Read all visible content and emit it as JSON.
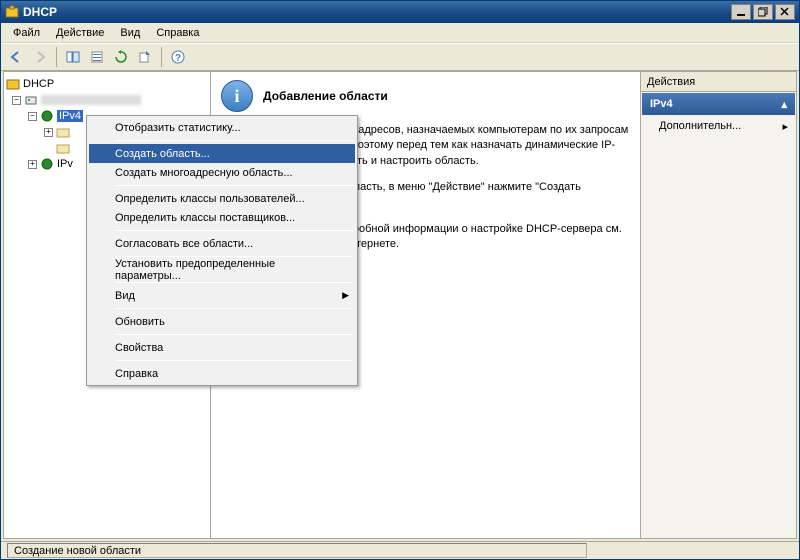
{
  "title": "DHCP",
  "menu": {
    "file": "Файл",
    "action": "Действие",
    "view": "Вид",
    "help": "Справка"
  },
  "tree": {
    "root": "DHCP",
    "server": "        ",
    "ipv4": "IPv4",
    "scope1": "",
    "scope2": "",
    "ipv6": "IPv"
  },
  "content": {
    "title": "Добавление области",
    "p1": "Область - это диапазон IP-адресов, назначаемых компьютерам по их запросам на получение IP-адреса. Поэтому перед тем как назначать динамические IP-адреса, необходимо создать и настроить область.",
    "p2": "Чтобы добавить новую область, в меню \"Действие\" нажмите \"Создать область\".",
    "p3": "Для получения более подробной информации о настройке DHCP-сервера см. электронную справку в Интернете."
  },
  "actions": {
    "header": "Действия",
    "subheader": "IPv4",
    "item1": "Дополнительн...",
    "arrow": "▸"
  },
  "context": {
    "i0": "Отобразить статистику...",
    "i1": "Создать область...",
    "i2": "Создать многоадресную область...",
    "i3": "Определить классы пользователей...",
    "i4": "Определить классы поставщиков...",
    "i5": "Согласовать все области...",
    "i6": "Установить предопределенные параметры...",
    "i7": "Вид",
    "i8": "Обновить",
    "i9": "Свойства",
    "i10": "Справка"
  },
  "status": "Создание новой области"
}
